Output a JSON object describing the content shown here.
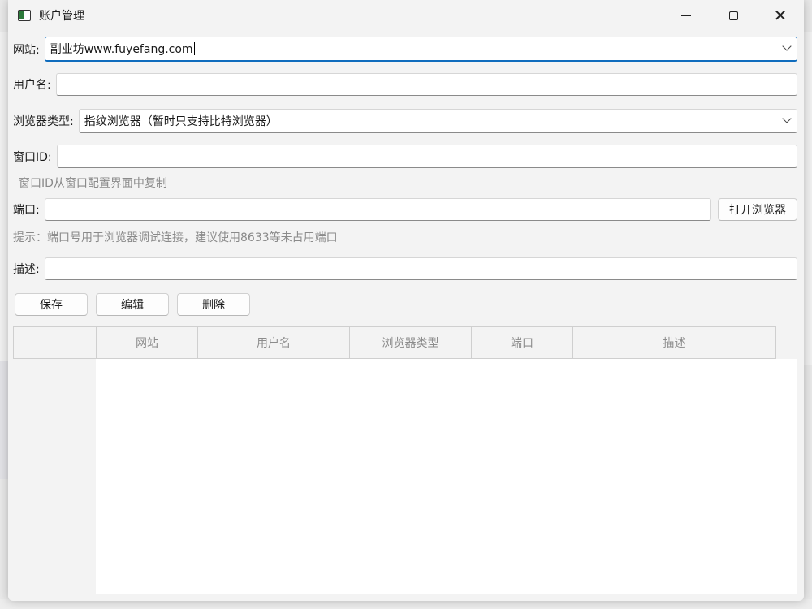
{
  "window": {
    "title": "账户管理",
    "controls": {
      "minimize_icon": "minimize-icon",
      "maximize_icon": "maximize-icon",
      "close_icon": "close-icon",
      "close_glyph": "✕"
    }
  },
  "form": {
    "website": {
      "label": "网站:",
      "value": "副业坊www.fuyefang.com"
    },
    "username": {
      "label": "用户名:",
      "value": ""
    },
    "browser_type": {
      "label": "浏览器类型:",
      "value": "指纹浏览器（暂时只支持比特浏览器）"
    },
    "window_id": {
      "label": "窗口ID:",
      "value": "",
      "hint": "窗口ID从窗口配置界面中复制"
    },
    "port": {
      "label": "端口:",
      "value": "",
      "open_browser_label": "打开浏览器",
      "hint": "提示：端口号用于浏览器调试连接，建议使用8633等未占用端口"
    },
    "description": {
      "label": "描述:",
      "value": ""
    }
  },
  "actions": {
    "save": "保存",
    "edit": "编辑",
    "delete": "删除"
  },
  "table": {
    "columns": [
      "网站",
      "用户名",
      "浏览器类型",
      "端口",
      "描述"
    ],
    "rows": []
  },
  "colors": {
    "accent": "#0f6cbd",
    "hint": "#8a8a8a",
    "header_text": "#8c8c8c"
  }
}
